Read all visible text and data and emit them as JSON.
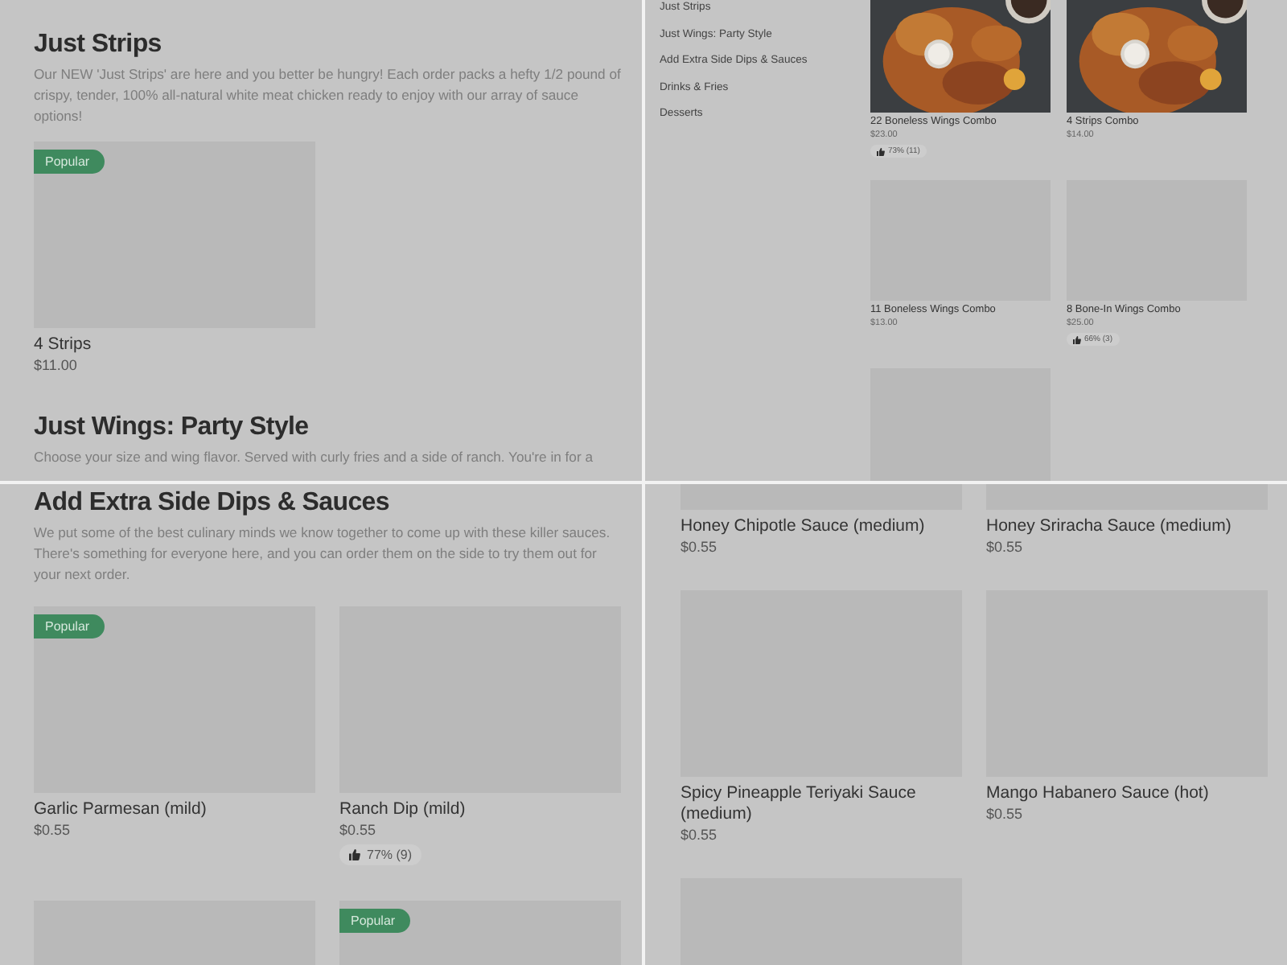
{
  "panels": [
    {
      "kind": "sections",
      "sections": [
        {
          "title": "Just Strips",
          "description": "Our NEW 'Just Strips' are here and you better be hungry! Each order packs a hefty 1/2 pound of crispy, tender, 100% all-natural white meat chicken ready to enjoy with our array of sauce options!",
          "items": [
            {
              "kind": "placeholder",
              "badge": "Popular",
              "name": "4 Strips",
              "price": "$11.00"
            }
          ]
        },
        {
          "title": "Just Wings: Party Style",
          "description": "Choose your size and wing flavor. Served with curly fries and a side of ranch. You're in for a"
        }
      ]
    },
    {
      "kind": "sidebar",
      "sidebar": {
        "items": [
          {
            "label": "Just Strips"
          },
          {
            "label": "Just Wings: Party Style"
          },
          {
            "label": "Add Extra Side Dips & Sauces"
          },
          {
            "label": "Drinks & Fries"
          },
          {
            "label": "Desserts"
          }
        ]
      },
      "items": [
        {
          "kind": "picture",
          "name": "22  Boneless Wings Combo",
          "price": "$23.00",
          "rating": "73% (11)"
        },
        {
          "kind": "picture",
          "name": "4 Strips Combo",
          "price": "$14.00"
        },
        {
          "kind": "placeholder",
          "name": "11 Boneless Wings Combo",
          "price": "$13.00"
        },
        {
          "kind": "placeholder",
          "name": "8 Bone-In Wings Combo",
          "price": "$25.00",
          "rating": "66% (3)"
        },
        {
          "kind": "placeholder"
        }
      ]
    },
    {
      "kind": "sections",
      "sections": [
        {
          "title": "Add Extra Side Dips & Sauces",
          "description": "We put some of the best culinary minds we know together to come up with these killer sauces. There's something for everyone here, and you can order them on the side to try them out for your next order.",
          "items": [
            {
              "kind": "placeholder",
              "badge": "Popular",
              "name": "Garlic Parmesan (mild)",
              "price": "$0.55"
            },
            {
              "kind": "placeholder",
              "name": "Ranch Dip (mild)",
              "price": "$0.55",
              "rating": "77% (9)"
            },
            {
              "kind": "placeholder"
            },
            {
              "kind": "placeholder",
              "badge": "Popular"
            }
          ]
        }
      ]
    },
    {
      "kind": "grid",
      "items": [
        {
          "kind": "placeholder",
          "name": "Honey Chipotle Sauce (medium)",
          "price": "$0.55"
        },
        {
          "kind": "placeholder",
          "name": "Honey Sriracha Sauce (medium)",
          "price": "$0.55"
        },
        {
          "kind": "placeholder",
          "name": "Spicy Pineapple Teriyaki Sauce (medium)",
          "price": "$0.55"
        },
        {
          "kind": "placeholder",
          "name": "Mango Habanero Sauce (hot)",
          "price": "$0.55"
        },
        {
          "kind": "placeholder"
        }
      ]
    }
  ]
}
